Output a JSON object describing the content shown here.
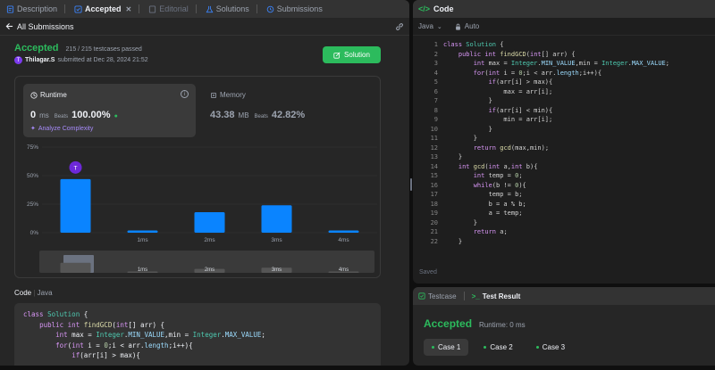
{
  "left_tabs": [
    {
      "label": "Description",
      "icon": "description-icon"
    },
    {
      "label": "Accepted",
      "icon": "accepted-icon",
      "close": "✕"
    },
    {
      "label": "Editorial",
      "icon": "editorial-icon"
    },
    {
      "label": "Solutions",
      "icon": "flask-icon"
    },
    {
      "label": "Submissions",
      "icon": "history-icon"
    }
  ],
  "all_submissions": "All Submissions",
  "result": {
    "status": "Accepted",
    "testcases": "215 / 215 testcases passed",
    "user": "Thilagar.S",
    "submitted_text": "submitted at Dec 28, 2024 21:52",
    "avatar_letter": "T"
  },
  "solution_button": "Solution",
  "runtime": {
    "label": "Runtime",
    "value": "0",
    "unit": "ms",
    "beats_label": "Beats",
    "beats": "100.00%",
    "analyze": "Analyze Complexity"
  },
  "memory": {
    "label": "Memory",
    "value": "43.38",
    "unit": "MB",
    "beats_label": "Beats",
    "beats": "42.82%"
  },
  "chart_data": {
    "type": "bar",
    "categories": [
      "0ms",
      "1ms",
      "2ms",
      "3ms",
      "4ms"
    ],
    "x_tick_labels": [
      "1ms",
      "2ms",
      "3ms",
      "4ms"
    ],
    "values": [
      47,
      2,
      18,
      24,
      2
    ],
    "yticks": [
      "75%",
      "50%",
      "25%",
      "0%"
    ],
    "ylim": [
      0,
      75
    ],
    "marker": {
      "category": "0ms",
      "label": "T"
    },
    "grid": true,
    "bar_color": "#0a84ff"
  },
  "code_section": {
    "label": "Code",
    "lang": "Java"
  },
  "left_code_lines": [
    "class Solution {",
    "    public int findGCD(int[] arr) {",
    "        int max = Integer.MIN_VALUE,min = Integer.MAX_VALUE;",
    "        for(int i = 0;i < arr.length;i++){",
    "            if(arr[i] > max){"
  ],
  "editor": {
    "title": "Code",
    "language": "Java",
    "mode": "Auto",
    "saved": "Saved",
    "lines": [
      "class Solution {",
      "    public int findGCD(int[] arr) {",
      "        int max = Integer.MIN_VALUE,min = Integer.MAX_VALUE;",
      "        for(int i = 0;i < arr.length;i++){",
      "            if(arr[i] > max){",
      "                max = arr[i];",
      "            }",
      "            if(arr[i] < min){",
      "                min = arr[i];",
      "            }",
      "        }",
      "        return gcd(max,min);",
      "    }",
      "    int gcd(int a,int b){",
      "        int temp = 0;",
      "        while(b != 0){",
      "            temp = b;",
      "            b = a % b;",
      "            a = temp;",
      "        }",
      "        return a;",
      "    }"
    ]
  },
  "testcase": {
    "tab1": "Testcase",
    "tab2": "Test Result",
    "status": "Accepted",
    "runtime": "Runtime: 0 ms",
    "cases": [
      "Case 1",
      "Case 2",
      "Case 3"
    ]
  },
  "colors": {
    "accent_green": "#2cbb5d",
    "bar_blue": "#0a84ff",
    "panel": "#262626"
  }
}
